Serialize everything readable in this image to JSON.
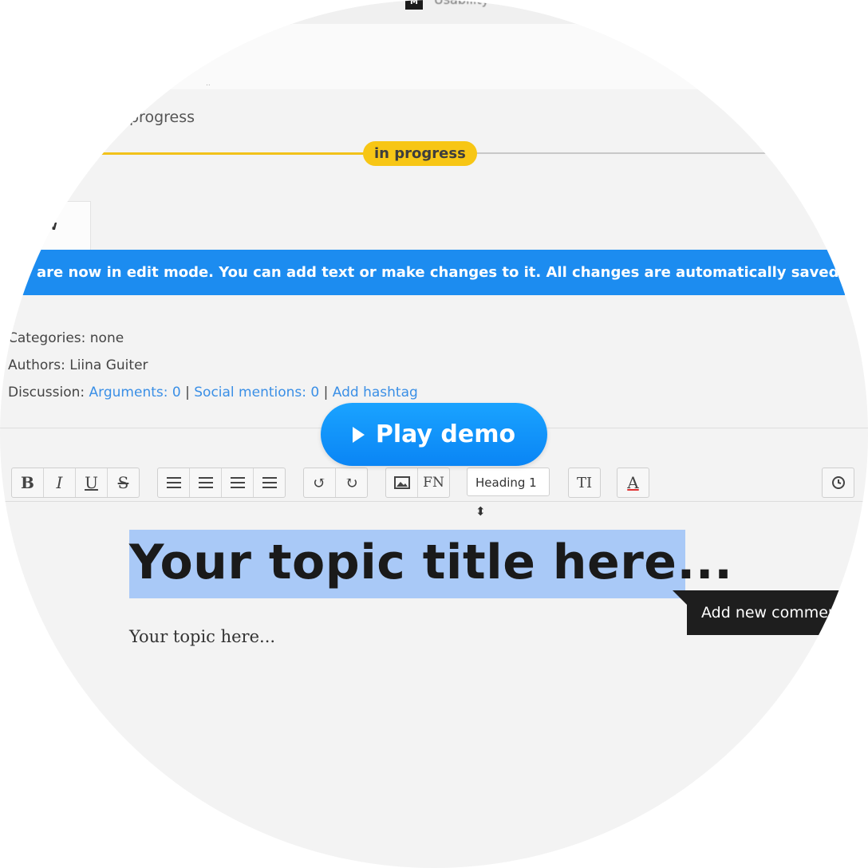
{
  "header": {
    "app_title": "Usability"
  },
  "status": {
    "label": "progress",
    "pill": "in progress"
  },
  "tab": {
    "label": "w"
  },
  "banner": {
    "text": "are now in edit mode. You can add text or make changes to it. All changes are automatically saved."
  },
  "meta": {
    "categories": "Categories: none",
    "authors": "Authors: Liina Guiter",
    "discussion_label": "Discussion:",
    "arguments": "Arguments: 0",
    "separator": "|",
    "social": "Social mentions: 0",
    "hashtag": "Add hashtag"
  },
  "play_button": {
    "label": "Play demo"
  },
  "toolbar": {
    "bold": "B",
    "italic": "I",
    "underline": "U",
    "strike": "S",
    "footnote": "FN",
    "heading_select": "Heading 1 ⬍",
    "text_size": "TI",
    "text_color": "A"
  },
  "editor": {
    "title": "Your topic title here...",
    "body": "Your topic here...",
    "tooltip": "Add new comment"
  },
  "colors": {
    "banner_blue": "#1c8cf0",
    "status_yellow": "#f7c615",
    "play_blue": "#0a8bf7",
    "selection": "#a9c9f7"
  }
}
